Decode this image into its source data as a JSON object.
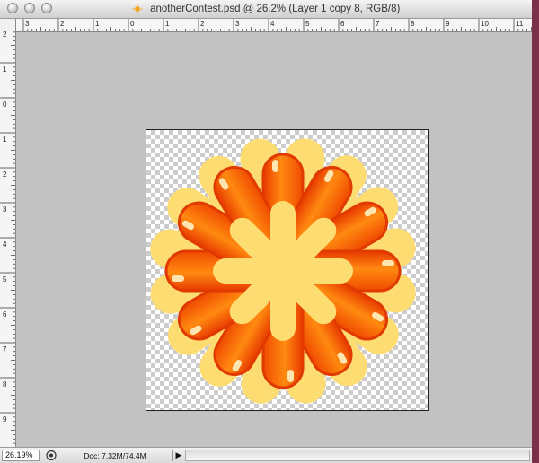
{
  "window": {
    "title": "anotherContest.psd @ 26.2% (Layer 1 copy 8, RGB/8)",
    "icons": {
      "close": "close-icon",
      "minimize": "minimize-icon",
      "zoom": "zoom-icon",
      "document": "psd-document-icon"
    }
  },
  "ruler_top": {
    "labels": [
      "3",
      "2",
      "1",
      "0",
      "1",
      "2",
      "3",
      "4",
      "5",
      "6",
      "7",
      "8",
      "9",
      "10",
      "11"
    ]
  },
  "ruler_left": {
    "labels": [
      "2",
      "1",
      "0",
      "1",
      "2",
      "3",
      "4",
      "5",
      "6",
      "7",
      "8",
      "9"
    ]
  },
  "status": {
    "zoom": "26.19%",
    "doc_info": "Doc: 7.32M/74.4M",
    "arrow": "▶"
  },
  "colors": {
    "pasteboard": "#c2c2c2",
    "petal_orange": "#ff7a00",
    "petal_orange_dark": "#e03a00",
    "petal_yellow": "#fddc72",
    "center_yellow": "#fddc72"
  }
}
